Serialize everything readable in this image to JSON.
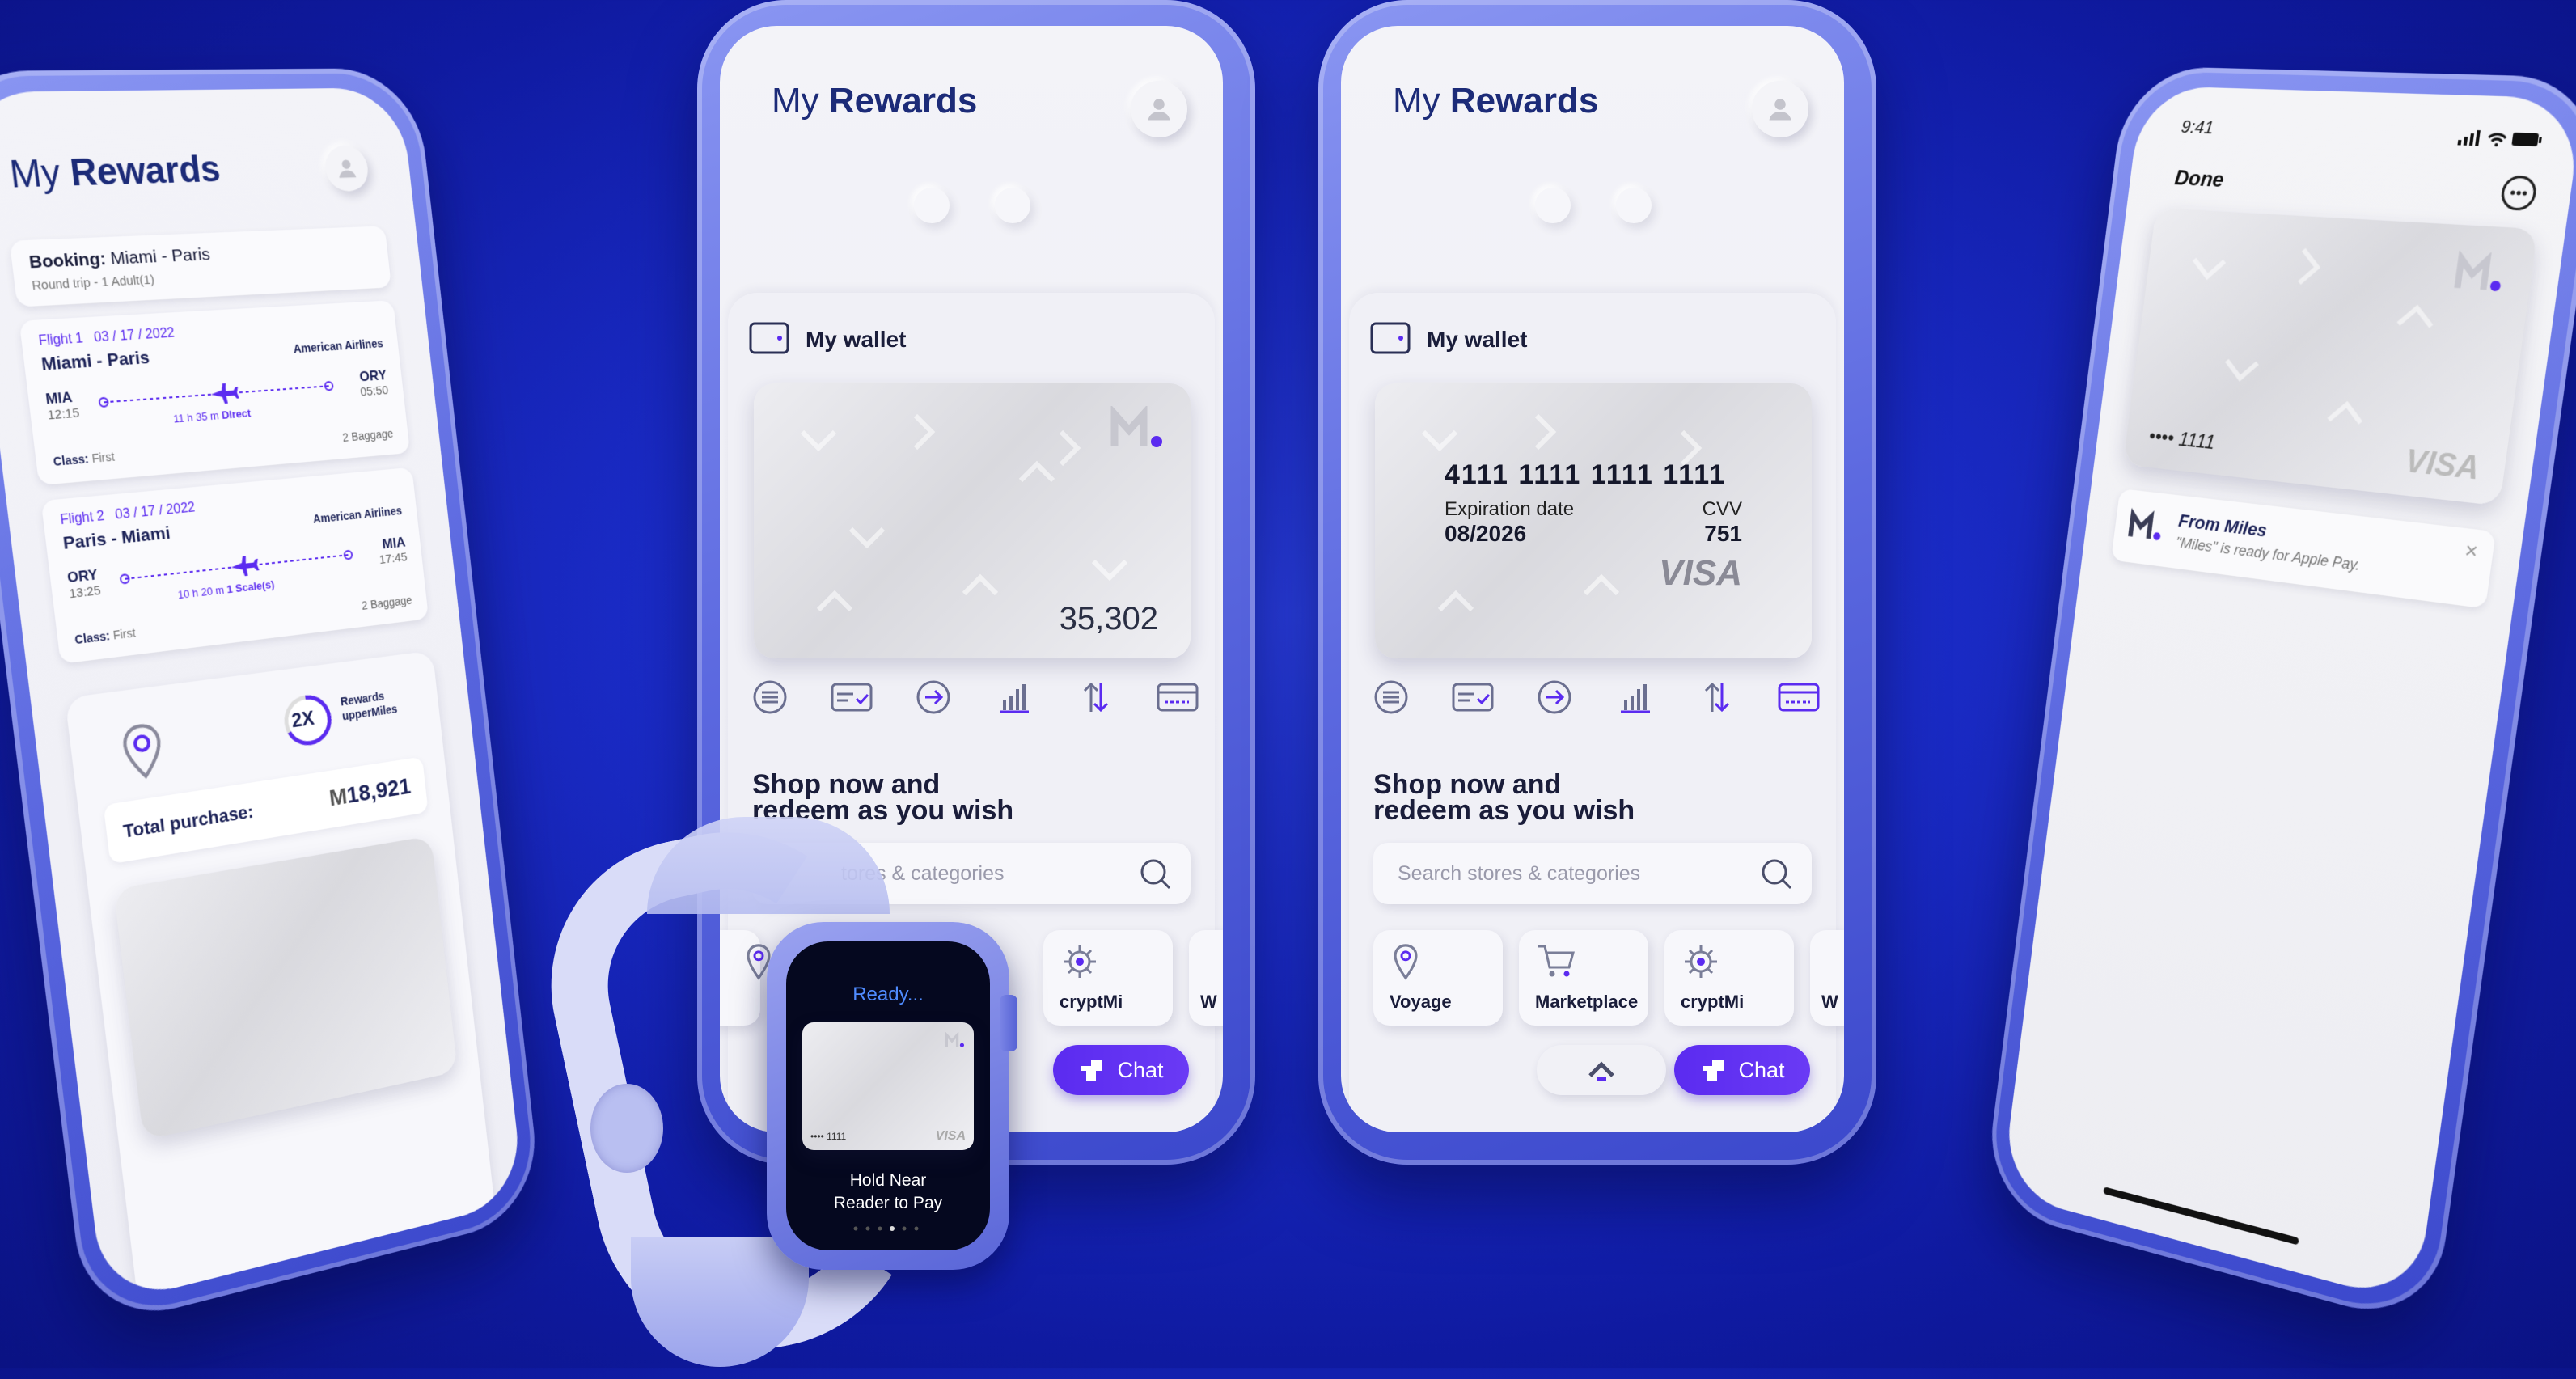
{
  "app": {
    "title_prefix": "My",
    "title_bold": "Rewards"
  },
  "left_phone": {
    "booking_label": "Booking:",
    "booking_route": "Miami - Paris",
    "booking_sub": "Round trip - 1 Adult(1)",
    "flights": [
      {
        "label": "Flight 1",
        "date": "03 / 17 / 2022",
        "route": "Miami - Paris",
        "airline": "American Airlines",
        "from_code": "MIA",
        "from_time": "12:15",
        "to_code": "ORY",
        "to_time": "05:50",
        "duration": "11 h 35 m",
        "stops": "Direct",
        "class_label": "Class:",
        "class_value": "First",
        "baggage": "2 Baggage"
      },
      {
        "label": "Flight 2",
        "date": "03 / 17 / 2022",
        "route": "Paris - Miami",
        "airline": "American Airlines",
        "from_code": "ORY",
        "from_time": "13:25",
        "to_code": "MIA",
        "to_time": "17:45",
        "duration": "10 h 20 m",
        "stops": "1 Scale(s)",
        "class_label": "Class:",
        "class_value": "First",
        "baggage": "2 Baggage"
      }
    ],
    "rewards_badge": "2X",
    "rewards_line1": "Rewards",
    "rewards_line2": "upperMiles",
    "total_label": "Total purchase:",
    "total_value": "18,921"
  },
  "wallet": {
    "label": "My wallet",
    "balance": "35,302",
    "card_number": "4111 1111 1111 1111",
    "exp_label": "Expiration date",
    "exp_value": "08/2026",
    "cvv_label": "CVV",
    "cvv_value": "751",
    "brand": "VISA"
  },
  "shop": {
    "heading_line1": "Shop now and",
    "heading_line2": "redeem as you wish",
    "search_placeholder": "Search stores & categories",
    "search_partial": "tores & categories",
    "categories": [
      "Voyage",
      "Marketplace",
      "cryptMi",
      "W"
    ]
  },
  "chat_label": "Chat",
  "watch": {
    "status": "Ready...",
    "card_digits": "•••• 1111",
    "card_brand": "VISA",
    "instruction_line1": "Hold Near",
    "instruction_line2": "Reader to Pay"
  },
  "right_phone": {
    "time": "9:41",
    "done_label": "Done",
    "card_digits": "•••• 1111",
    "card_brand": "VISA",
    "notif_title": "From Miles",
    "notif_body": "\"Miles\" is ready for Apple Pay.",
    "notif_close": "×"
  },
  "colors": {
    "accent": "#5b2bf0",
    "title": "#1c2b78",
    "bg_blue": "#1a2bc6"
  }
}
